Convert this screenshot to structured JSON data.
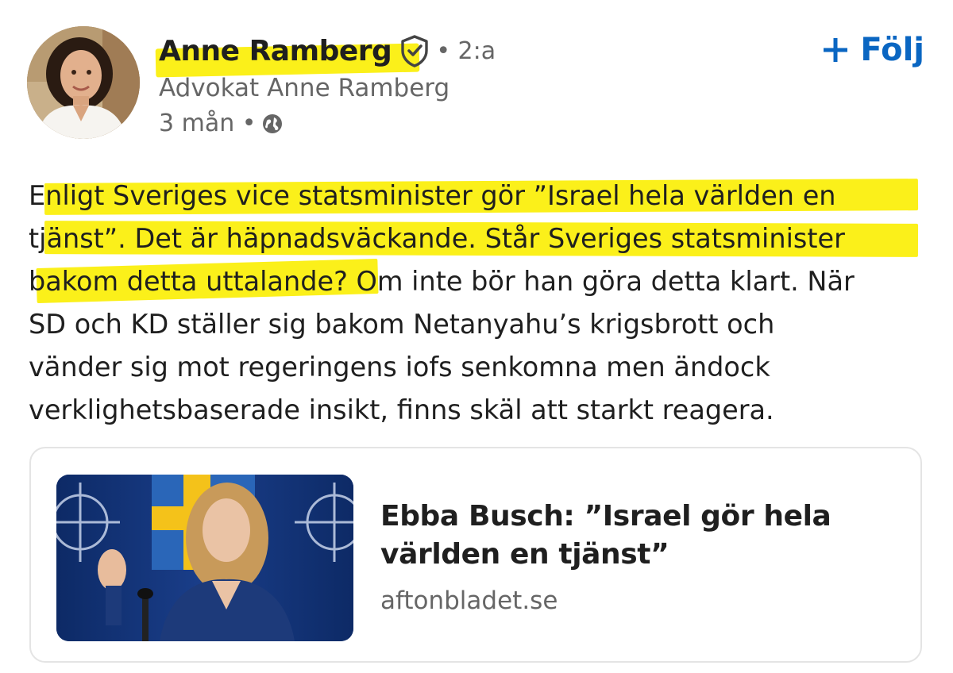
{
  "author": {
    "name": "Anne Ramberg",
    "connection_degree": "• 2:a",
    "headline": "Advokat Anne Ramberg",
    "time_ago": "3 mån •",
    "verified_icon": "verified-shield-icon",
    "visibility_icon": "globe-icon"
  },
  "follow_button": {
    "plus": "+",
    "label": "Följ"
  },
  "post": {
    "lines": [
      "Enligt Sveriges vice statsminister gör ”Israel hela världen en",
      "tjänst”. Det är häpnadsväckande. Står Sveriges statsminister",
      "bakom detta uttalande? Om inte bör han göra detta klart. När",
      "SD och KD ställer sig bakom Netanyahu’s krigsbrott och",
      "vänder sig mot regeringens iofs senkomna men ändock",
      "verklighetsbaserade insikt, finns skäl att starkt reagera."
    ]
  },
  "link_card": {
    "title": "Ebba Busch: ”Israel gör hela världen en tjänst”",
    "domain": "aftonbladet.se"
  },
  "colors": {
    "highlight": "#fbf01a",
    "accent": "#0a66c2",
    "text": "#1f1f1f",
    "muted": "#666666"
  }
}
